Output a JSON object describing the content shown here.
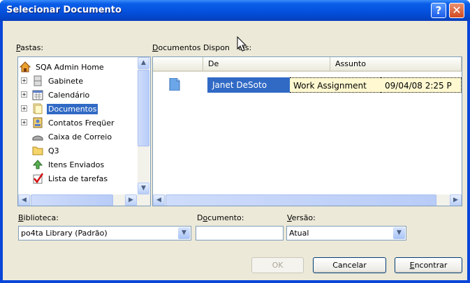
{
  "window": {
    "title": "Selecionar Documento",
    "help_glyph": "?",
    "close_glyph": "✕"
  },
  "folders": {
    "label_mnemonic": "P",
    "label_rest": "astas:",
    "items": [
      {
        "label": "SQA Admin Home",
        "icon": "home-icon"
      },
      {
        "label": "Gabinete",
        "icon": "cabinet-icon"
      },
      {
        "label": "Calendário",
        "icon": "calendar-icon"
      },
      {
        "label": "Documentos",
        "icon": "documents-icon",
        "selected": true
      },
      {
        "label": "Contatos Freqüer",
        "icon": "contacts-icon"
      },
      {
        "label": "Caixa de Correio",
        "icon": "mailbox-icon"
      },
      {
        "label": "Q3",
        "icon": "folder-icon"
      },
      {
        "label": "Itens Enviados",
        "icon": "sent-items-icon"
      },
      {
        "label": "Lista de tarefas",
        "icon": "task-list-icon"
      }
    ]
  },
  "documents": {
    "label_mnemonic": "D",
    "label_rest": "ocumentos Dispon",
    "label_tail": "eis:",
    "columns": [
      "De",
      "Assunto"
    ],
    "rows": [
      {
        "from": "Janet DeSoto",
        "subject": "Work Assignment",
        "date": "09/04/08 2:25 P"
      }
    ]
  },
  "library": {
    "label_mnemonic": "B",
    "label_rest": "iblioteca:",
    "value": "po4ta Library  (Padrão)"
  },
  "document_field": {
    "label_pre": "D",
    "label_mnemonic": "o",
    "label_rest": "cumento:",
    "value": ""
  },
  "version": {
    "label_mnemonic": "V",
    "label_rest": "ersão:",
    "value": "Atual"
  },
  "buttons": {
    "ok": "OK",
    "cancel": "Cancelar",
    "find_mnemonic": "E",
    "find_rest": "ncontrar"
  }
}
